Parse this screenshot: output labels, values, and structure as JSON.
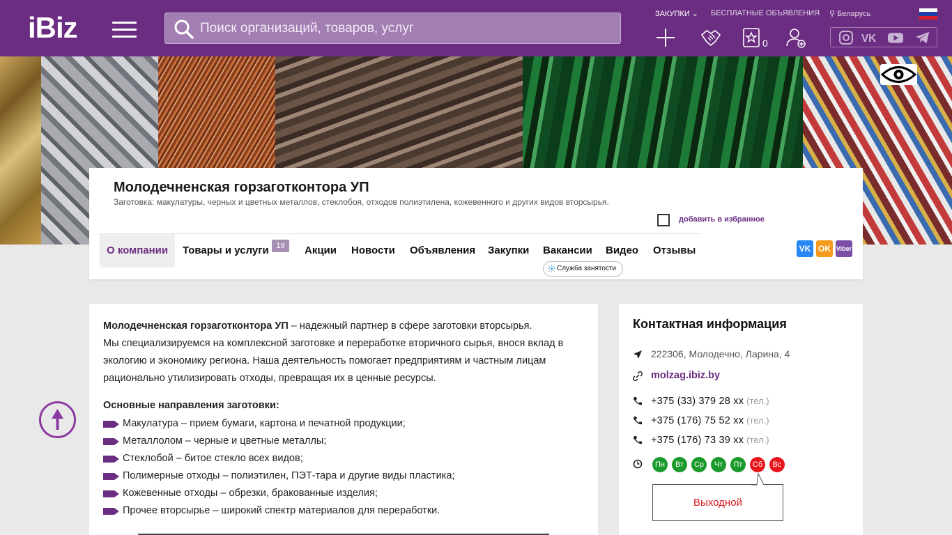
{
  "header": {
    "logo": "iBiz",
    "search_placeholder": "Поиск организаций, товаров, услуг",
    "nav_purchases": "ЗАКУПКИ",
    "nav_free_ads": "БЕСПЛАТНЫЕ ОБЪЯВЛЕНИЯ",
    "location": "Беларусь",
    "favorites_count": "0",
    "icons": [
      "add-icon",
      "handshake-icon",
      "star-icon",
      "add-user-icon"
    ],
    "social": [
      "instagram-icon",
      "vk-icon",
      "youtube-icon",
      "telegram-icon"
    ],
    "colors": {
      "brand": "#6b2d82"
    }
  },
  "company": {
    "title": "Молодечненская горзаготконтора УП",
    "subtitle": "Заготовка: макулатуры, черных и цветных металлов, стеклобоя, отходов полиэтилена, кожевенного и других видов вторсырья.",
    "add_favorite": "добавить в избранное",
    "tabs": [
      {
        "label": "О компании"
      },
      {
        "label": "Товары и услуги"
      },
      {
        "label": "Акции"
      },
      {
        "label": "Новости"
      },
      {
        "label": "Объявления"
      },
      {
        "label": "Закупки"
      },
      {
        "label": "Вакансии"
      },
      {
        "label": "Видео"
      },
      {
        "label": "Отзывы"
      }
    ],
    "products_count": "19",
    "employment_service": "Служба занятости",
    "share": [
      "VK",
      "OK",
      "Viber"
    ]
  },
  "about": {
    "intro_bold": "Молодечненская горзаготконтора УП",
    "intro_rest": " – надежный партнер в сфере заготовки вторсырья.",
    "intro_p2": "Мы специализируемся на комплексной заготовке и переработке вторичного сырья, внося вклад в экологию и экономику региона. Наша деятельность помогает предприятиям и частным лицам рационально утилизировать отходы, превращая их в ценные ресурсы.",
    "directions_title": "Основные направления заготовки:",
    "directions": [
      "Макулатура – прием бумаги, картона и печатной продукции;",
      "Металлолом – черные и цветные металлы;",
      "Стеклобой – битое стекло всех видов;",
      "Полимерные отходы – полиэтилен, ПЭТ-тара и другие виды пластика;",
      "Кожевенные отходы – обрезки, бракованные изделия;",
      "Прочее вторсырье – широкий спектр материалов для переработки."
    ]
  },
  "contacts": {
    "title": "Контактная информация",
    "address": "222306, Молодечно, Ларина, 4",
    "website": "molzag.ibiz.by",
    "phones": [
      {
        "number": "+375 (33) 379 28 хх",
        "type": "(тел.)"
      },
      {
        "number": "+375 (176) 75 52 хх",
        "type": "(тел.)"
      },
      {
        "number": "+375 (176) 73 39 хх",
        "type": "(тел.)"
      }
    ],
    "days": [
      {
        "label": "Пн",
        "color": "#1a9a2a"
      },
      {
        "label": "Вт",
        "color": "#1a9a2a"
      },
      {
        "label": "Ср",
        "color": "#1a9a2a"
      },
      {
        "label": "Чт",
        "color": "#1a9a2a"
      },
      {
        "label": "Пт",
        "color": "#1a9a2a"
      },
      {
        "label": "Сб",
        "color": "#e8151b"
      },
      {
        "label": "Вс",
        "color": "#e8151b"
      }
    ],
    "status": "Выходной"
  }
}
